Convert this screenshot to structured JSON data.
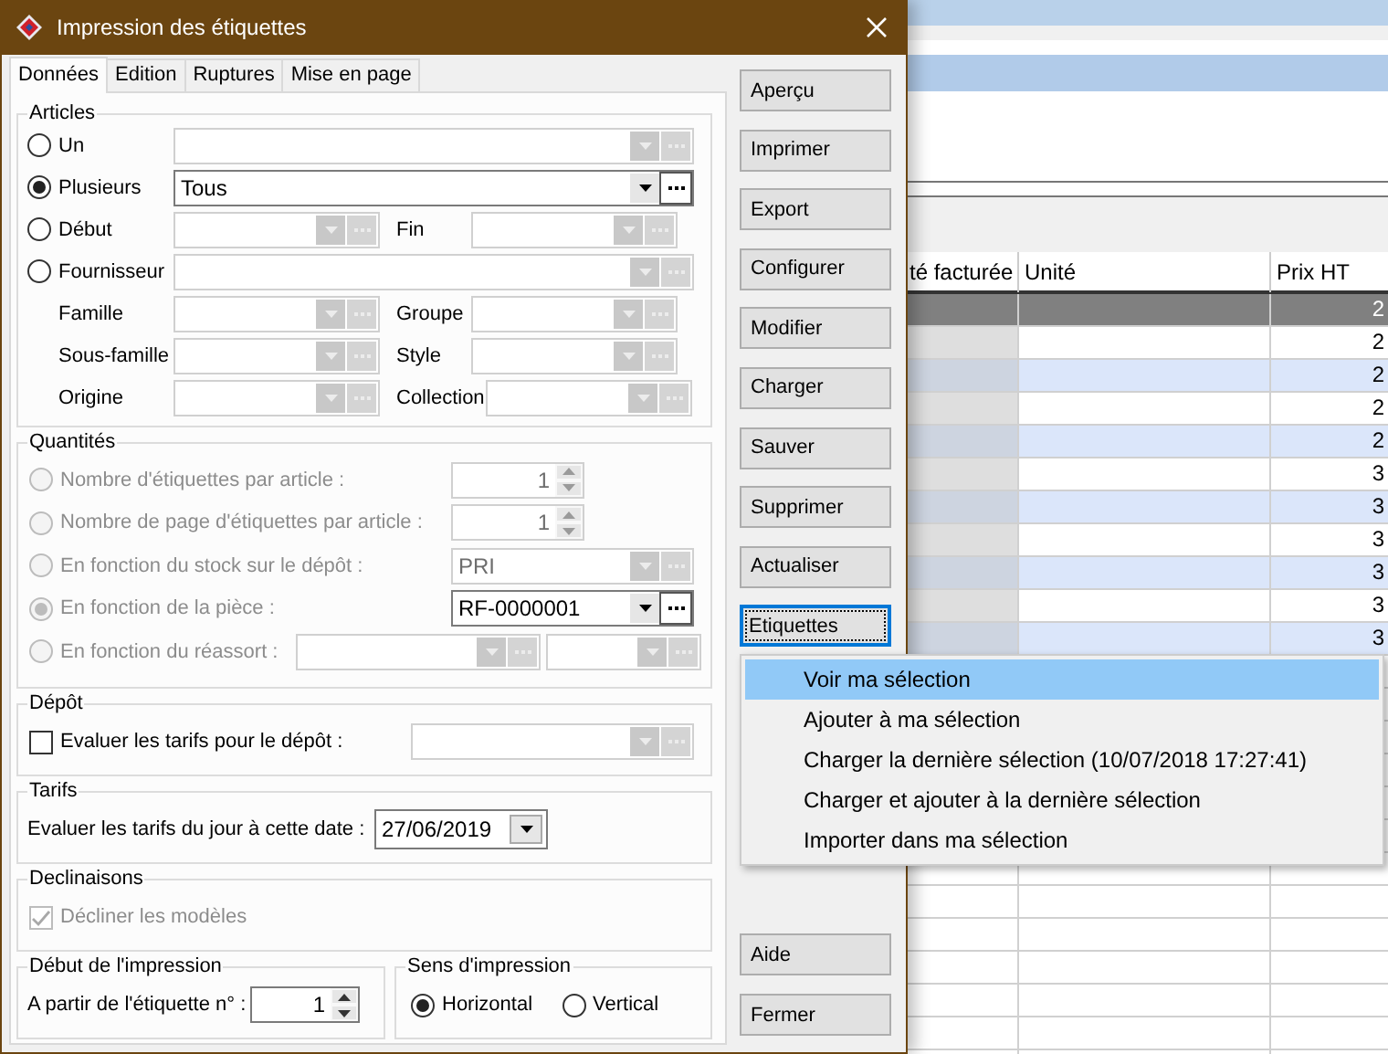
{
  "window": {
    "title": "Impression des étiquettes"
  },
  "tabs": [
    {
      "label": "Données",
      "selected": true
    },
    {
      "label": "Edition",
      "selected": false
    },
    {
      "label": "Ruptures",
      "selected": false
    },
    {
      "label": "Mise en page",
      "selected": false
    }
  ],
  "articles": {
    "title": "Articles",
    "rows": [
      {
        "kind": "radio",
        "label": "Un",
        "selected": false,
        "combo": {
          "enabled": false
        }
      },
      {
        "kind": "radio",
        "label": "Plusieurs",
        "selected": true,
        "combo": {
          "enabled": true,
          "value": "Tous"
        }
      },
      {
        "kind": "radio",
        "label": "Début",
        "selected": false,
        "combo": {
          "enabled": false
        },
        "pair": {
          "label": "Fin",
          "combo": {
            "enabled": false
          }
        }
      },
      {
        "kind": "radio",
        "label": "Fournisseur",
        "selected": false,
        "combo": {
          "enabled": false
        }
      },
      {
        "kind": "plain",
        "label": "Famille",
        "combo": {
          "enabled": false
        },
        "pair": {
          "label": "Groupe",
          "combo": {
            "enabled": false
          }
        }
      },
      {
        "kind": "plain",
        "label": "Sous-famille",
        "combo": {
          "enabled": false
        },
        "pair": {
          "label": "Style",
          "combo": {
            "enabled": false
          }
        }
      },
      {
        "kind": "plain",
        "label": "Origine",
        "combo": {
          "enabled": false
        },
        "pair": {
          "label": "Collection",
          "combo": {
            "enabled": false
          }
        }
      }
    ]
  },
  "quantities": {
    "title": "Quantités",
    "rows": [
      {
        "kind": "spin",
        "label": "Nombre d'étiquettes par article :",
        "selected": false,
        "disabled": true,
        "value": "1"
      },
      {
        "kind": "spin",
        "label": "Nombre de page d'étiquettes par article :",
        "selected": false,
        "disabled": true,
        "value": "1"
      },
      {
        "kind": "combo",
        "label": "En fonction du stock sur le dépôt :",
        "selected": false,
        "disabled": true,
        "combo": {
          "enabled": false,
          "value": "PRI"
        }
      },
      {
        "kind": "combo",
        "label": "En fonction de la pièce :",
        "selected": true,
        "disabled": true,
        "combo": {
          "enabled": true,
          "value": "RF-0000001"
        }
      },
      {
        "kind": "combo_pair",
        "label": "En fonction du réassort :",
        "selected": false,
        "disabled": true,
        "combos": [
          {
            "enabled": false
          },
          {
            "enabled": false
          }
        ]
      }
    ]
  },
  "depot": {
    "title": "Dépôt",
    "checkbox": {
      "label": "Evaluer les tarifs pour le dépôt :",
      "checked": false,
      "disabled": false
    },
    "combo": {
      "enabled": false
    }
  },
  "tarifs": {
    "title": "Tarifs",
    "label": "Evaluer les tarifs du jour à cette date :",
    "date": "27/06/2019"
  },
  "declinaisons": {
    "title": "Declinaisons",
    "checkbox": {
      "label": "Décliner les modèles",
      "checked": true,
      "disabled": true
    }
  },
  "start": {
    "title": "Début de l'impression",
    "label": "A partir de l'étiquette n° :",
    "value": "1"
  },
  "direction": {
    "title": "Sens d'impression",
    "options": [
      {
        "label": "Horizontal",
        "selected": true
      },
      {
        "label": "Vertical",
        "selected": false
      }
    ]
  },
  "buttons": [
    {
      "label": "Aperçu",
      "focused": false
    },
    {
      "label": "Imprimer",
      "focused": false
    },
    {
      "label": "Export",
      "focused": false
    },
    {
      "label": "Configurer",
      "focused": false
    },
    {
      "label": "Modifier",
      "focused": false
    },
    {
      "label": "Charger",
      "focused": false
    },
    {
      "label": "Sauver",
      "focused": false
    },
    {
      "label": "Supprimer",
      "focused": false
    },
    {
      "label": "Actualiser",
      "focused": false
    },
    {
      "label": "Etiquettes",
      "focused": true
    }
  ],
  "bottom_buttons": [
    {
      "label": "Aide"
    },
    {
      "label": "Fermer"
    }
  ],
  "menu": [
    {
      "label": "Voir ma sélection",
      "selected": true
    },
    {
      "label": "Ajouter à ma sélection",
      "selected": false
    },
    {
      "label": "Charger la dernière sélection (10/07/2018 17:27:41)",
      "selected": false
    },
    {
      "label": "Charger et ajouter à la dernière sélection",
      "selected": false
    },
    {
      "label": "Importer dans ma sélection",
      "selected": false
    }
  ],
  "background_table": {
    "columns": [
      "té facturée",
      "Unité",
      "Prix HT"
    ],
    "rows": [
      {
        "selected": true,
        "price": "2"
      },
      {
        "selected": false,
        "price": "2"
      },
      {
        "selected": false,
        "price": "2"
      },
      {
        "selected": false,
        "price": "2"
      },
      {
        "selected": false,
        "price": "2"
      },
      {
        "selected": false,
        "price": "3"
      },
      {
        "selected": false,
        "price": "3"
      },
      {
        "selected": false,
        "price": "3"
      },
      {
        "selected": false,
        "price": "3"
      },
      {
        "selected": false,
        "price": "3"
      },
      {
        "selected": false,
        "price": "3"
      }
    ]
  }
}
